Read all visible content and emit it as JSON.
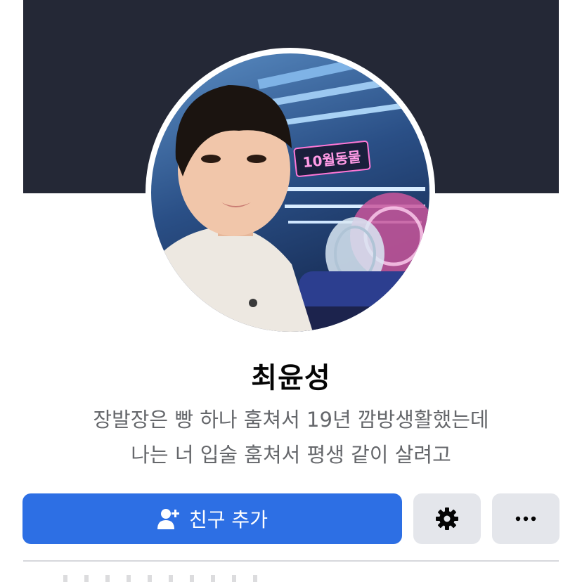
{
  "profile": {
    "name": "최윤성",
    "bio_line1": "장발장은 빵 하나 훔쳐서 19년 깜방생활했는데",
    "bio_line2": "나는 너 입술 훔쳐서 평생 같이 살려고"
  },
  "actions": {
    "add_friend_label": "친구 추가",
    "add_friend_icon": "add-person-icon",
    "settings_icon": "gear-icon",
    "more_icon": "more-dots-icon"
  },
  "colors": {
    "cover": "#242836",
    "primary_button": "#2d6fe4",
    "secondary_button": "#e4e6eb",
    "bio_text": "#65676b"
  },
  "avatar_sign_text": "10월동물"
}
